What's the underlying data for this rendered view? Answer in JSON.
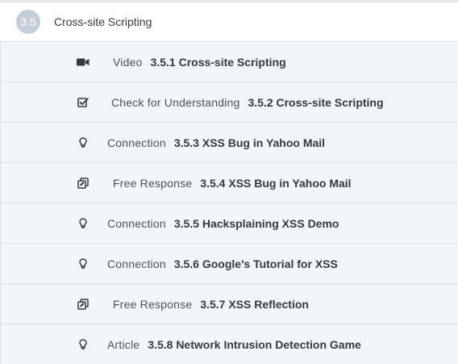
{
  "section": {
    "number": "3.5",
    "title": "Cross-site Scripting"
  },
  "items": [
    {
      "icon": "video-camera-icon",
      "type": "Video",
      "title": "3.5.1 Cross-site Scripting"
    },
    {
      "icon": "checkbox-icon",
      "type": "Check for Understanding",
      "title": "3.5.2 Cross-site Scripting"
    },
    {
      "icon": "lightbulb-icon",
      "type": "Connection",
      "title": "3.5.3 XSS Bug in Yahoo Mail"
    },
    {
      "icon": "free-response-icon",
      "type": "Free Response",
      "title": "3.5.4 XSS Bug in Yahoo Mail"
    },
    {
      "icon": "lightbulb-icon",
      "type": "Connection",
      "title": "3.5.5 Hacksplaining XSS Demo"
    },
    {
      "icon": "lightbulb-icon",
      "type": "Connection",
      "title": "3.5.6 Google's Tutorial for XSS"
    },
    {
      "icon": "free-response-icon",
      "type": "Free Response",
      "title": "3.5.7 XSS Reflection"
    },
    {
      "icon": "lightbulb-icon",
      "type": "Article",
      "title": "3.5.8 Network Intrusion Detection Game"
    }
  ]
}
